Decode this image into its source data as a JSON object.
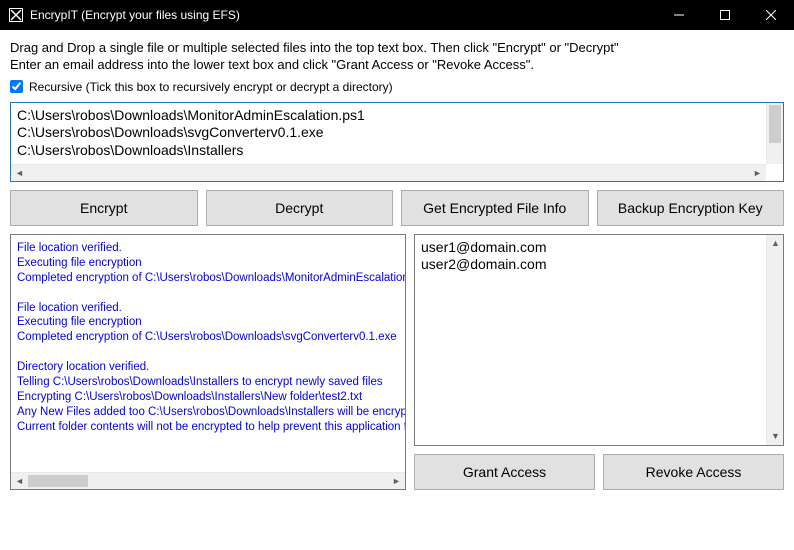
{
  "window": {
    "title": "EncrypIT (Encrypt your files using EFS)"
  },
  "instructions": {
    "line1": "Drag and Drop a single file or multiple selected files into the top text box. Then click \"Encrypt\" or \"Decrypt\"",
    "line2": "Enter an email address into the lower text box and click \"Grant Access or \"Revoke Access\"."
  },
  "recursive": {
    "checked": true,
    "label": "Recursive (Tick this box to recursively encrypt or decrypt a directory)"
  },
  "file_list": "C:\\Users\\robos\\Downloads\\MonitorAdminEscalation.ps1\nC:\\Users\\robos\\Downloads\\svgConverterv0.1.exe\nC:\\Users\\robos\\Downloads\\Installers",
  "buttons": {
    "encrypt": "Encrypt",
    "decrypt": "Decrypt",
    "get_info": "Get Encrypted File Info",
    "backup_key": "Backup Encryption Key",
    "grant": "Grant Access",
    "revoke": "Revoke Access"
  },
  "log": "File location verified.\nExecuting file encryption\nCompleted encryption of C:\\Users\\robos\\Downloads\\MonitorAdminEscalation.\n\nFile location verified.\nExecuting file encryption\nCompleted encryption of C:\\Users\\robos\\Downloads\\svgConverterv0.1.exe\n\nDirectory location verified.\nTelling C:\\Users\\robos\\Downloads\\Installers to encrypt newly saved files\nEncrypting C:\\Users\\robos\\Downloads\\Installers\\New folder\\test2.txt\nAny New Files added too C:\\Users\\robos\\Downloads\\Installers will be encryp\nCurrent folder contents will not be encrypted to help prevent this application fro",
  "emails": "user1@domain.com\nuser2@domain.com"
}
